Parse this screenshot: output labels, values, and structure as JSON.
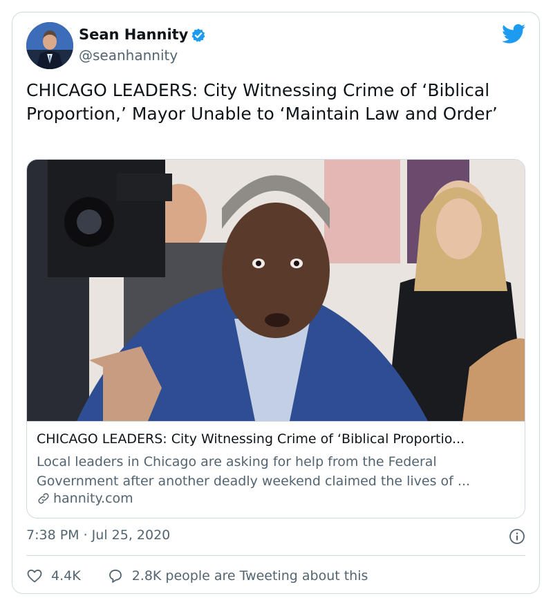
{
  "author": {
    "name": "Sean Hannity",
    "handle": "@seanhannity",
    "verified": true
  },
  "tweet": {
    "text": "CHICAGO LEADERS: City Witnessing Crime of ‘Biblical Proportion,’ Mayor Unable to ‘Maintain Law and Order’"
  },
  "link_card": {
    "title": "CHICAGO LEADERS: City Witnessing Crime of ‘Biblical Proportio...",
    "description": "Local leaders in Chicago are asking for help from the Federal Government after another deadly weekend claimed the lives of ...",
    "domain": "hannity.com"
  },
  "meta": {
    "timestamp": "7:38 PM · Jul 25, 2020"
  },
  "actions": {
    "likes": "4.4K",
    "replies_text": "2.8K people are Tweeting about this"
  },
  "icons": {
    "avatar": "avatar",
    "verified": "verified-badge-icon",
    "platform": "twitter-bird-icon",
    "link": "link-icon",
    "info": "info-icon",
    "like": "heart-icon",
    "reply": "speech-bubble-icon"
  },
  "colors": {
    "brand": "#1d9bf0",
    "text_primary": "#0f1419",
    "text_secondary": "#536471",
    "border": "#cfd9de"
  }
}
